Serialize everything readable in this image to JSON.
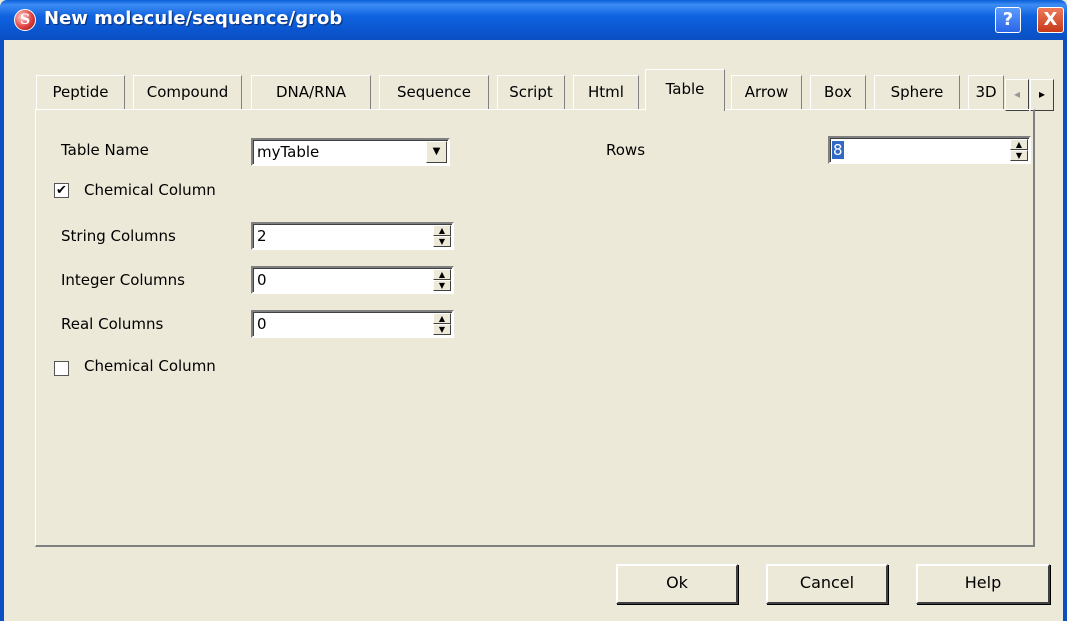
{
  "window": {
    "title": "New molecule/sequence/grob",
    "help_glyph": "?",
    "close_glyph": "X",
    "app_icon_glyph": "S"
  },
  "tabs": [
    {
      "label": "Peptide"
    },
    {
      "label": "Compound"
    },
    {
      "label": "DNA/RNA"
    },
    {
      "label": "Sequence"
    },
    {
      "label": "Script"
    },
    {
      "label": "Html"
    },
    {
      "label": "Table",
      "active": true
    },
    {
      "label": "Arrow"
    },
    {
      "label": "Box"
    },
    {
      "label": "Sphere"
    },
    {
      "label": "3D"
    }
  ],
  "tab_scroll": {
    "left": "◂",
    "right": "▸"
  },
  "form": {
    "table_name_label": "Table Name",
    "table_name_value": "myTable",
    "rows_label": "Rows",
    "rows_value": "8",
    "chemical_column_1_label": "Chemical Column",
    "chemical_column_1_checked": true,
    "string_columns_label": "String Columns",
    "string_columns_value": "2",
    "integer_columns_label": "Integer Columns",
    "integer_columns_value": "0",
    "real_columns_label": "Real Columns",
    "real_columns_value": "0",
    "chemical_column_2_label": "Chemical Column",
    "chemical_column_2_checked": false
  },
  "buttons": {
    "ok": "Ok",
    "cancel": "Cancel",
    "help": "Help"
  },
  "glyphs": {
    "check": "✔",
    "dropdown": "▼",
    "spin_up": "▲",
    "spin_down": "▼"
  }
}
